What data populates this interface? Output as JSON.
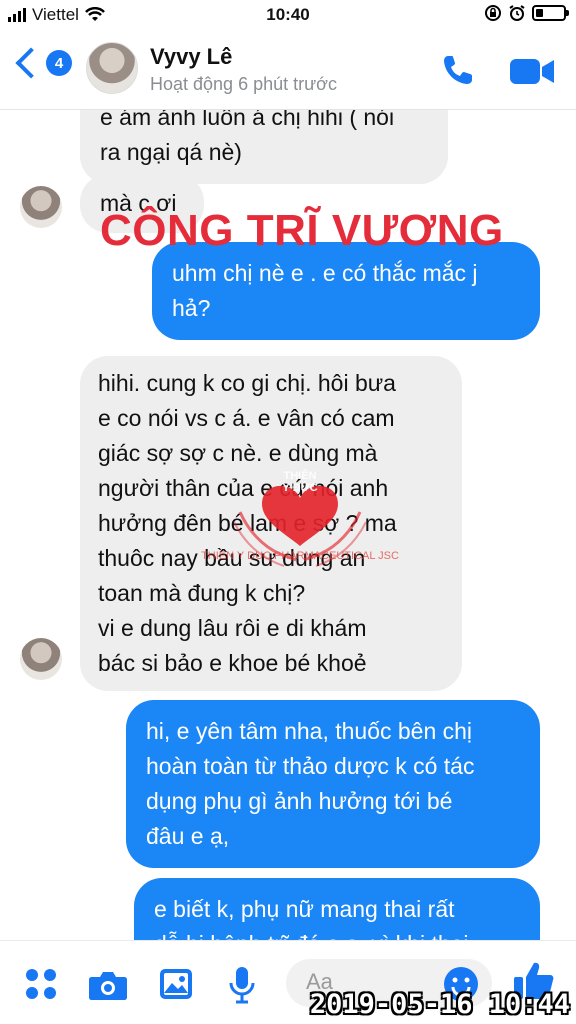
{
  "status_bar": {
    "carrier": "Viettel",
    "time": "10:40",
    "battery_level": 0.25
  },
  "header": {
    "unread_count": "4",
    "contact_name": "Vyvy Lê",
    "contact_status": "Hoạt động 6 phút trước",
    "icons": [
      "back-chevron-icon",
      "phone-icon",
      "video-camera-icon"
    ],
    "accent_color": "#1877f2"
  },
  "messages": [
    {
      "direction": "in",
      "lines": [
        "e ám ảnh luôn á chị hihi ( nói",
        "ra ngại qá nè)"
      ]
    },
    {
      "direction": "in",
      "lines": [
        "mà c ơi"
      ]
    },
    {
      "direction": "out",
      "lines": [
        "uhm chị nè e . e có thắc mắc j",
        "hả?"
      ]
    },
    {
      "direction": "in",
      "lines": [
        "hihi. cung k co gi chị. hôi bưa",
        "e co nói vs c á. e vân có cam",
        "giác sợ sợ c nè. e dùng mà",
        "người thân của e cứ nói anh",
        "hưởng đên bé lam e sợ ? ma",
        "thuôc nay bầu sư dung an",
        "toan mà đung k chị?",
        "vi e dung lâu rôi e di khám",
        "bác si bảo e khoe bé khoẻ"
      ]
    },
    {
      "direction": "out",
      "lines": [
        "hi, e yên tâm nha, thuốc bên chị",
        "hoàn toàn từ thảo dược k có tác",
        "dụng phụ gì ảnh hưởng tới bé",
        "đâu e ạ,"
      ]
    },
    {
      "direction": "out",
      "lines": [
        "e biết k, phụ nữ mang thai rất",
        "dễ bị bệnh trĩ đó e ạ, vì khi thai"
      ]
    }
  ],
  "overlay": {
    "title": "CÔNG TRĨ VƯƠNG",
    "title_color": "#e42c3a",
    "logo_text": [
      "THIÊN",
      "Y ĐỨC"
    ],
    "logo_caption": "THIEN Y DUC PHARMACEUTICAL JSC"
  },
  "composer": {
    "placeholder": "Aa",
    "icons": [
      "apps-icon",
      "camera-icon",
      "photo-icon",
      "microphone-icon",
      "emoji-icon",
      "thumbs-up-icon"
    ]
  },
  "timestamp": "2019-05-16 10:44"
}
